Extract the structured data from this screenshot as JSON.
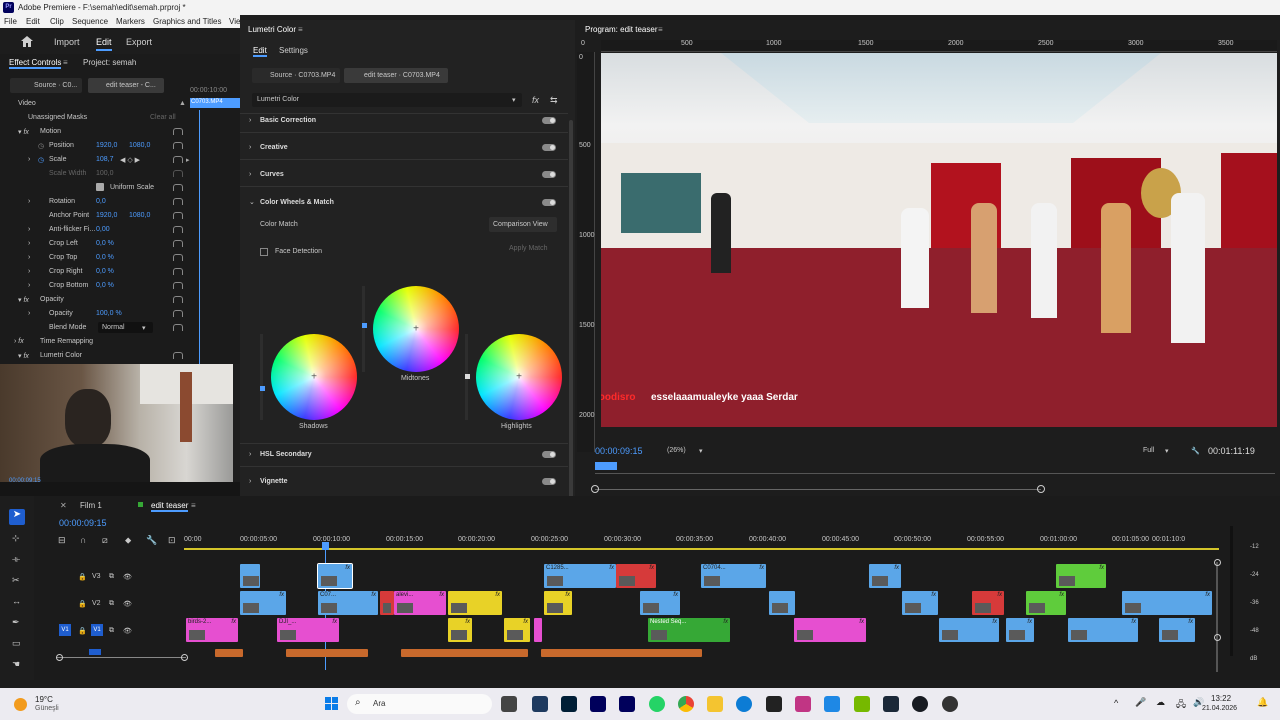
{
  "window": {
    "title": "Adobe Premiere - F:\\semah\\edit\\semah.prproj *"
  },
  "menu": [
    "File",
    "Edit",
    "Clip",
    "Sequence",
    "Markers",
    "Graphics and Titles",
    "Vie"
  ],
  "header": {
    "home": "Home",
    "import": "Import",
    "edit": "Edit",
    "export": "Export"
  },
  "effect_controls": {
    "tab": "Effect Controls",
    "tab2": "Project: semah",
    "source_btn": "Source · C0...",
    "seq_btn": "edit teaser - C...",
    "timecode": "00:00:10:00",
    "clip_label": "C0703.MP4",
    "video_label": "Video",
    "unassigned": "Unassigned Masks",
    "clear_all": "Clear all",
    "motion": "Motion",
    "position_label": "Position",
    "position_x": "1920,0",
    "position_y": "1080,0",
    "scale_label": "Scale",
    "scale_val": "108,7",
    "scale_width_label": "Scale Width",
    "scale_width_val": "100,0",
    "uniform_scale": "Uniform Scale",
    "rotation_label": "Rotation",
    "rotation_val": "0,0",
    "anchor_label": "Anchor Point",
    "anchor_x": "1920,0",
    "anchor_y": "1080,0",
    "antiflicker_label": "Anti-flicker Fi...",
    "antiflicker_val": "0,00",
    "crop_left_label": "Crop Left",
    "crop_left_val": "0,0 %",
    "crop_top_label": "Crop Top",
    "crop_top_val": "0,0 %",
    "crop_right_label": "Crop Right",
    "crop_right_val": "0,0 %",
    "crop_bottom_label": "Crop Bottom",
    "crop_bottom_val": "0,0 %",
    "opacity_group": "Opacity",
    "opacity_label": "Opacity",
    "opacity_val": "100,0 %",
    "blend_label": "Blend Mode",
    "blend_val": "Normal",
    "time_remap": "Time Remapping",
    "lumetri": "Lumetri Color",
    "bottom_tc": "00:00:09:15"
  },
  "lumetri": {
    "title": "Lumetri Color",
    "tab_edit": "Edit",
    "tab_settings": "Settings",
    "src_tab": "Source · C0703.MP4",
    "seq_tab": "edit teaser · C0703.MP4",
    "effect_select": "Lumetri Color",
    "basic": "Basic Correction",
    "creative": "Creative",
    "curves": "Curves",
    "wheels": "Color Wheels & Match",
    "color_match": "Color Match",
    "comparison_view": "Comparison View",
    "face_detection": "Face Detection",
    "apply_match": "Apply Match",
    "midtones": "Midtones",
    "shadows": "Shadows",
    "highlights": "Highlights",
    "hsl": "HSL Secondary",
    "vignette": "Vignette"
  },
  "program": {
    "title": "Program: edit teaser",
    "ruler": [
      "0",
      "500",
      "1000",
      "1500",
      "2000",
      "2500",
      "3000",
      "3500"
    ],
    "vruler": [
      "0",
      "500",
      "1000",
      "1500",
      "2000"
    ],
    "caption_user": "woodisro",
    "caption_text": "esselaaamualeyke yaaa Serdar",
    "timecode": "00:00:09:15",
    "zoom": "(26%)",
    "quality": "Full",
    "duration": "00:01:11:19"
  },
  "timeline": {
    "tab1": "Film 1",
    "tab2": "edit teaser",
    "timecode": "00:00:09:15",
    "ticks": [
      "00:00",
      "00:00:05:00",
      "00:00:10:00",
      "00:00:15:00",
      "00:00:20:00",
      "00:00:25:00",
      "00:00:30:00",
      "00:00:35:00",
      "00:00:40:00",
      "00:00:45:00",
      "00:00:50:00",
      "00:00:55:00",
      "00:01:00:00",
      "00:01:05:00",
      "00:01:10:0"
    ],
    "tracks": [
      "V3",
      "V2",
      "V1"
    ],
    "clip_labels": {
      "c1": "C07...",
      "c2": "C1285...",
      "c3": "C0704...",
      "c4": "birds-2...",
      "c5": "DJI_...",
      "c6": "alevi...",
      "c7": "Nested Seq...",
      "c8": "C07..."
    },
    "meter": [
      "-12",
      "-24",
      "-36",
      "-48",
      "dB"
    ]
  },
  "webcam": {
    "timecode": "00:00:09:15"
  },
  "taskbar": {
    "weather_temp": "19°C",
    "weather_place": "Güneşli",
    "search": "Ara",
    "time": "13:22",
    "date": "21.04.2026"
  }
}
